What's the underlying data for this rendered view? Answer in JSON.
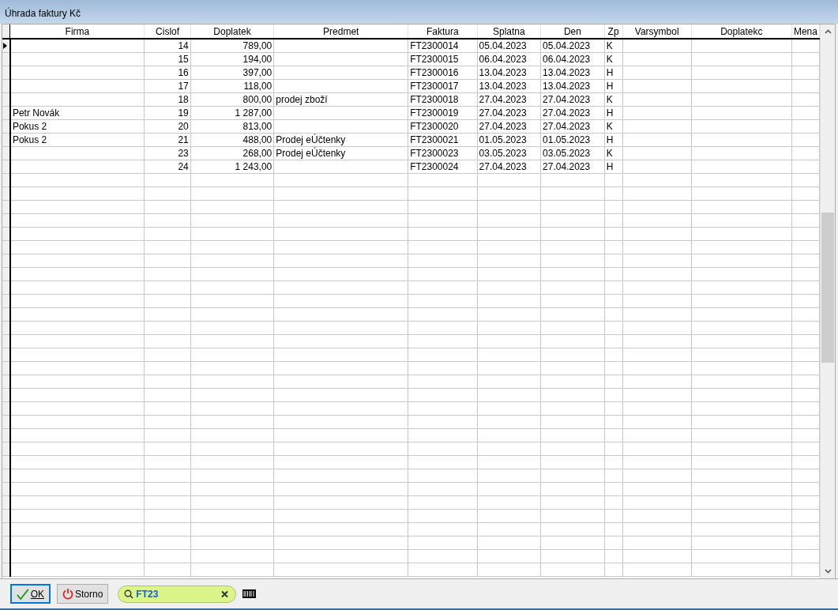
{
  "window": {
    "title": "Úhrada faktury Kč"
  },
  "table": {
    "columns": [
      {
        "label": "Firma"
      },
      {
        "label": "Cislof"
      },
      {
        "label": "Doplatek"
      },
      {
        "label": "Predmet"
      },
      {
        "label": "Faktura"
      },
      {
        "label": "Splatna"
      },
      {
        "label": "Den"
      },
      {
        "label": "Zp"
      },
      {
        "label": "Varsymbol"
      },
      {
        "label": "Doplatekc"
      },
      {
        "label": "Mena"
      }
    ],
    "rows": [
      {
        "selected": true,
        "cells": [
          "",
          "14",
          "789,00",
          "",
          "FT2300014",
          "05.04.2023",
          "05.04.2023",
          "K",
          "",
          "",
          ""
        ]
      },
      {
        "selected": false,
        "cells": [
          "",
          "15",
          "194,00",
          "",
          "FT2300015",
          "06.04.2023",
          "06.04.2023",
          "K",
          "",
          "",
          ""
        ]
      },
      {
        "selected": false,
        "cells": [
          "",
          "16",
          "397,00",
          "",
          "FT2300016",
          "13.04.2023",
          "13.04.2023",
          "H",
          "",
          "",
          ""
        ]
      },
      {
        "selected": false,
        "cells": [
          "",
          "17",
          "118,00",
          "",
          "FT2300017",
          "13.04.2023",
          "13.04.2023",
          "H",
          "",
          "",
          ""
        ]
      },
      {
        "selected": false,
        "cells": [
          "",
          "18",
          "800,00",
          "prodej zboží",
          "FT2300018",
          "27.04.2023",
          "27.04.2023",
          "K",
          "",
          "",
          ""
        ]
      },
      {
        "selected": false,
        "cells": [
          "Petr Novák",
          "19",
          "1 287,00",
          "",
          "FT2300019",
          "27.04.2023",
          "27.04.2023",
          "H",
          "",
          "",
          ""
        ]
      },
      {
        "selected": false,
        "cells": [
          "Pokus 2",
          "20",
          "813,00",
          "",
          "FT2300020",
          "27.04.2023",
          "27.04.2023",
          "K",
          "",
          "",
          ""
        ]
      },
      {
        "selected": false,
        "cells": [
          "Pokus 2",
          "21",
          "488,00",
          "Prodej eÚčtenky",
          "FT2300021",
          "01.05.2023",
          "01.05.2023",
          "H",
          "",
          "",
          ""
        ]
      },
      {
        "selected": false,
        "cells": [
          "",
          "23",
          "268,00",
          "Prodej eÚčtenky",
          "FT2300023",
          "03.05.2023",
          "03.05.2023",
          "K",
          "",
          "",
          ""
        ]
      },
      {
        "selected": false,
        "cells": [
          "",
          "24",
          "1 243,00",
          "",
          "FT2300024",
          "27.04.2023",
          "27.04.2023",
          "H",
          "",
          "",
          ""
        ]
      }
    ]
  },
  "buttons": [
    {
      "kind": "ok",
      "label": "OK"
    },
    {
      "kind": "cancel",
      "label": "Storno"
    }
  ],
  "search": {
    "value": "FT23"
  }
}
